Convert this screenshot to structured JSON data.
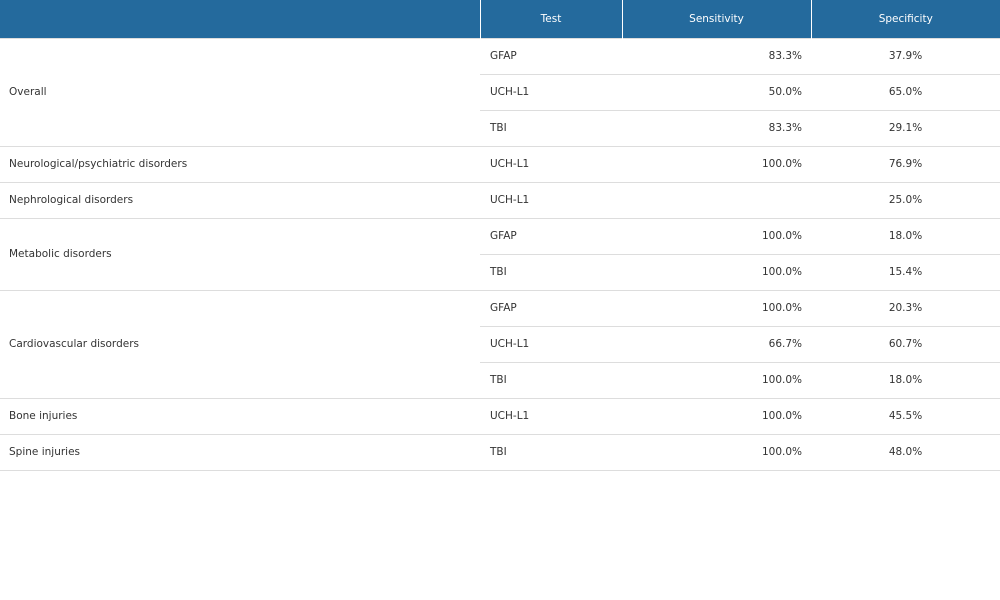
{
  "table": {
    "columns": [
      "",
      "Test",
      "Sensitivity",
      "Specificity"
    ],
    "groups": [
      {
        "name": "Overall",
        "rows": [
          {
            "test": "GFAP",
            "sensitivity": "83.3%",
            "specificity": "37.9%"
          },
          {
            "test": "UCH-L1",
            "sensitivity": "50.0%",
            "specificity": "65.0%"
          },
          {
            "test": "TBI",
            "sensitivity": "83.3%",
            "specificity": "29.1%"
          }
        ]
      },
      {
        "name": "Neurological/psychiatric disorders",
        "rows": [
          {
            "test": "UCH-L1",
            "sensitivity": "100.0%",
            "specificity": "76.9%"
          }
        ]
      },
      {
        "name": "Nephrological disorders",
        "rows": [
          {
            "test": "UCH-L1",
            "sensitivity": "",
            "specificity": "25.0%"
          }
        ]
      },
      {
        "name": "Metabolic disorders",
        "rows": [
          {
            "test": "GFAP",
            "sensitivity": "100.0%",
            "specificity": "18.0%"
          },
          {
            "test": "TBI",
            "sensitivity": "100.0%",
            "specificity": "15.4%"
          }
        ]
      },
      {
        "name": "Cardiovascular disorders",
        "rows": [
          {
            "test": "GFAP",
            "sensitivity": "100.0%",
            "specificity": "20.3%"
          },
          {
            "test": "UCH-L1",
            "sensitivity": "66.7%",
            "specificity": "60.7%"
          },
          {
            "test": "TBI",
            "sensitivity": "100.0%",
            "specificity": "18.0%"
          }
        ]
      },
      {
        "name": "Bone injuries",
        "rows": [
          {
            "test": "UCH-L1",
            "sensitivity": "100.0%",
            "specificity": "45.5%"
          }
        ]
      },
      {
        "name": "Spine injuries",
        "rows": [
          {
            "test": "TBI",
            "sensitivity": "100.0%",
            "specificity": "48.0%"
          }
        ]
      }
    ],
    "colors": {
      "header_bg": "#246a9d",
      "header_text": "#ffffff",
      "row_border": "#dddddd",
      "body_text": "#333333"
    }
  }
}
